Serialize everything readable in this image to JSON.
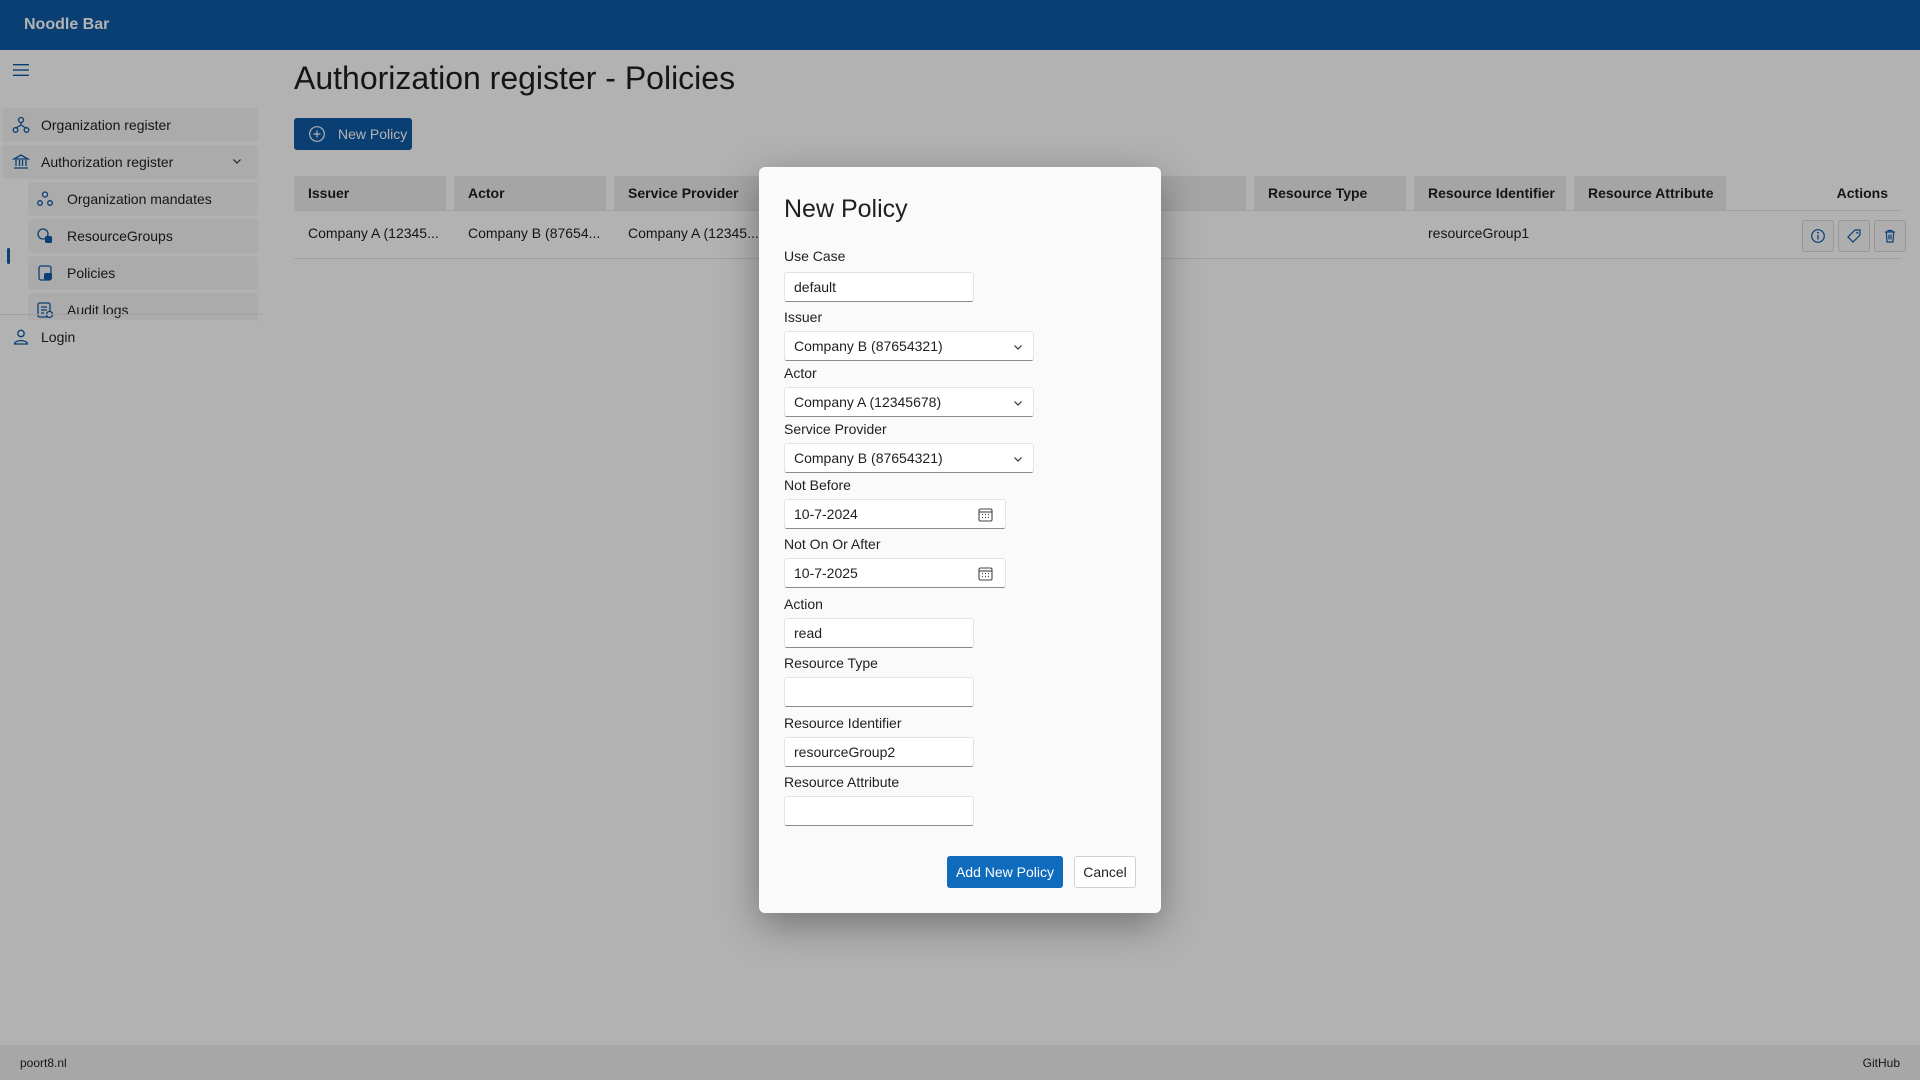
{
  "app": {
    "title": "Noodle Bar",
    "accent": "#0f5ba7"
  },
  "sidebar": {
    "items": [
      {
        "label": "Organization register",
        "icon": "organization-icon"
      },
      {
        "label": "Authorization register",
        "icon": "bank-icon",
        "expanded": true
      },
      {
        "label": "Organization mandates",
        "icon": "people-icon"
      },
      {
        "label": "ResourceGroups",
        "icon": "resource-group-icon"
      },
      {
        "label": "Policies",
        "icon": "policy-icon",
        "active": true
      },
      {
        "label": "Audit logs",
        "icon": "audit-log-icon"
      },
      {
        "label": "Login",
        "icon": "person-icon"
      }
    ]
  },
  "page": {
    "title": "Authorization register - Policies",
    "new_button": "New Policy"
  },
  "table": {
    "columns": [
      "Issuer",
      "Actor",
      "Service Provider",
      "Resource Type",
      "Resource Identifier",
      "Resource Attribute",
      "Actions"
    ],
    "rows": [
      {
        "issuer": "Company A (12345...",
        "actor": "Company B (87654...",
        "service_provider": "Company A (12345...",
        "resource_type": "",
        "resource_identifier": "resourceGroup1",
        "resource_attribute": ""
      }
    ]
  },
  "dialog": {
    "title": "New Policy",
    "fields": {
      "use_case": {
        "label": "Use Case",
        "value": "default"
      },
      "issuer": {
        "label": "Issuer",
        "value": "Company B (87654321)"
      },
      "actor": {
        "label": "Actor",
        "value": "Company A (12345678)"
      },
      "service_provider": {
        "label": "Service Provider",
        "value": "Company B (87654321)"
      },
      "not_before": {
        "label": "Not Before",
        "value": "10-7-2024"
      },
      "not_on_or_after": {
        "label": "Not On Or After",
        "value": "10-7-2025"
      },
      "action": {
        "label": "Action",
        "value": "read"
      },
      "resource_type": {
        "label": "Resource Type",
        "value": ""
      },
      "resource_identifier": {
        "label": "Resource Identifier",
        "value": "resourceGroup2"
      },
      "resource_attribute": {
        "label": "Resource Attribute",
        "value": ""
      }
    },
    "add_button": "Add New Policy",
    "cancel_button": "Cancel"
  },
  "footer": {
    "left": "poort8.nl",
    "right": "GitHub"
  }
}
